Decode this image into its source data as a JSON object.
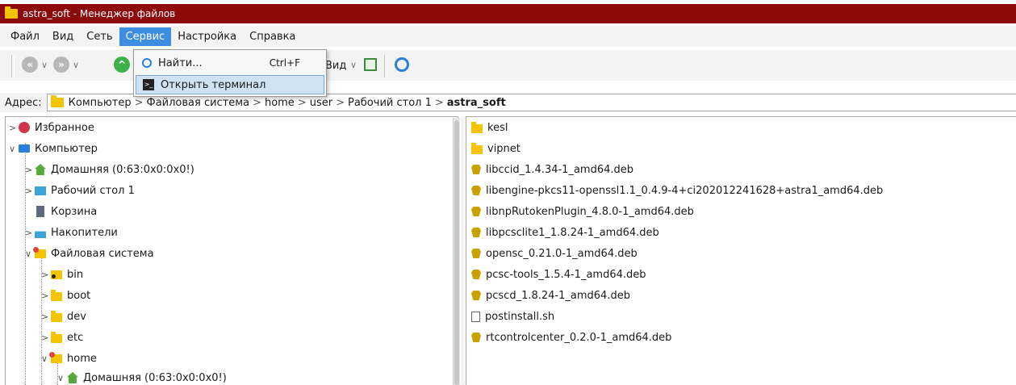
{
  "window": {
    "title": "astra_soft - Менеджер файлов"
  },
  "menubar": {
    "items": [
      {
        "label": "Файл",
        "active": false
      },
      {
        "label": "Вид",
        "active": false
      },
      {
        "label": "Сеть",
        "active": false
      },
      {
        "label": "Сервис",
        "active": true
      },
      {
        "label": "Настройка",
        "active": false
      },
      {
        "label": "Справка",
        "active": false
      }
    ]
  },
  "dropdown": {
    "items": [
      {
        "label": "Найти...",
        "shortcut": "Ctrl+F",
        "icon": "search-icon"
      },
      {
        "label": "Открыть терминал",
        "shortcut": "",
        "icon": "terminal-icon"
      }
    ]
  },
  "toolbar": {
    "view_label": "Вид"
  },
  "address": {
    "label": "Адрес:",
    "crumbs": [
      "Компьютер",
      "Файловая система",
      "home",
      "user",
      "Рабочий стол 1",
      "astra_soft"
    ]
  },
  "tree": [
    {
      "label": "Избранное",
      "icon": "heart-icon",
      "level": 0,
      "expanded": false
    },
    {
      "label": "Компьютер",
      "icon": "monitor-icon",
      "level": 0,
      "expanded": true
    },
    {
      "label": "Домашняя (0:63:0x0:0x0!)",
      "icon": "home-icon",
      "level": 1,
      "expanded": false
    },
    {
      "label": "Рабочий стол 1",
      "icon": "desktop-icon",
      "level": 1,
      "expanded": false
    },
    {
      "label": "Корзина",
      "icon": "trash-icon",
      "level": 1,
      "expanded": null
    },
    {
      "label": "Накопители",
      "icon": "drive-icon",
      "level": 1,
      "expanded": false
    },
    {
      "label": "Файловая система",
      "icon": "filesystem-icon",
      "level": 1,
      "expanded": true
    },
    {
      "label": "bin",
      "icon": "folder-icon",
      "level": 2,
      "expanded": false
    },
    {
      "label": "boot",
      "icon": "folder-icon",
      "level": 2,
      "expanded": false
    },
    {
      "label": "dev",
      "icon": "folder-icon",
      "level": 2,
      "expanded": false
    },
    {
      "label": "etc",
      "icon": "folder-icon",
      "level": 2,
      "expanded": false
    },
    {
      "label": "home",
      "icon": "folder-icon",
      "level": 2,
      "expanded": true
    },
    {
      "label": "Домашняя (0:63:0x0:0x0!)",
      "icon": "home-icon",
      "level": 3,
      "expanded": true
    }
  ],
  "files": [
    {
      "name": "kesl",
      "icon": "folder-icon"
    },
    {
      "name": "vipnet",
      "icon": "folder-icon"
    },
    {
      "name": "libccid_1.4.34-1_amd64.deb",
      "icon": "deb-package-icon"
    },
    {
      "name": "libengine-pkcs11-openssl1.1_0.4.9-4+ci202012241628+astra1_amd64.deb",
      "icon": "deb-package-icon"
    },
    {
      "name": "libnpRutokenPlugin_4.8.0-1_amd64.deb",
      "icon": "deb-package-icon"
    },
    {
      "name": "libpcsclite1_1.8.24-1_amd64.deb",
      "icon": "deb-package-icon"
    },
    {
      "name": "opensc_0.21.0-1_amd64.deb",
      "icon": "deb-package-icon"
    },
    {
      "name": "pcsc-tools_1.5.4-1_amd64.deb",
      "icon": "deb-package-icon"
    },
    {
      "name": "pcscd_1.8.24-1_amd64.deb",
      "icon": "deb-package-icon"
    },
    {
      "name": "postinstall.sh",
      "icon": "script-icon"
    },
    {
      "name": "rtcontrolcenter_0.2.0-1_amd64.deb",
      "icon": "deb-package-icon"
    }
  ]
}
